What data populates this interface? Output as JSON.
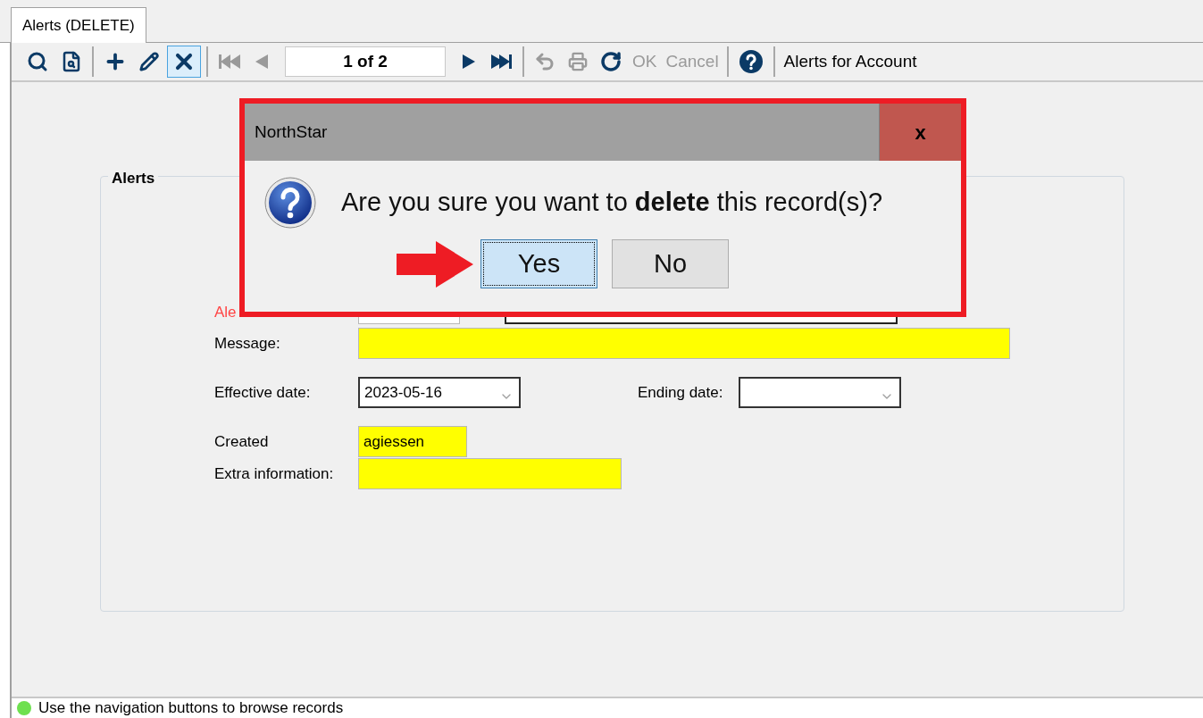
{
  "tab": {
    "label": "Alerts (DELETE)",
    "selected": true
  },
  "toolbar": [
    {
      "kind": "search",
      "disabled": false,
      "selected": false
    },
    {
      "kind": "find",
      "disabled": false,
      "selected": false
    },
    {
      "kind": "separator"
    },
    {
      "kind": "add",
      "disabled": false,
      "selected": false
    },
    {
      "kind": "edit",
      "disabled": false,
      "selected": false
    },
    {
      "kind": "delete",
      "disabled": false,
      "selected": true
    },
    {
      "kind": "separator"
    },
    {
      "kind": "first",
      "disabled": true,
      "selected": false
    },
    {
      "kind": "prev",
      "disabled": true,
      "selected": false
    },
    {
      "kind": "position",
      "text": "1 of 2"
    },
    {
      "kind": "next",
      "disabled": false,
      "selected": false
    },
    {
      "kind": "last",
      "disabled": false,
      "selected": false
    },
    {
      "kind": "separator"
    },
    {
      "kind": "undo",
      "disabled": true,
      "selected": false
    },
    {
      "kind": "print",
      "disabled": true,
      "selected": false
    },
    {
      "kind": "refresh",
      "disabled": false,
      "selected": false
    },
    {
      "kind": "text",
      "text": "OK",
      "disabled": true
    },
    {
      "kind": "text",
      "text": "Cancel",
      "disabled": true
    },
    {
      "kind": "separator"
    },
    {
      "kind": "help",
      "disabled": false,
      "selected": false
    },
    {
      "kind": "separator"
    },
    {
      "kind": "caption",
      "text": "Alerts for Account"
    }
  ],
  "group": {
    "title": "Alerts",
    "rows": [
      {
        "label": "Ale",
        "required": true,
        "fields": [
          {
            "kind": "hidden"
          }
        ]
      },
      {
        "label": "Message:",
        "required": false,
        "fields": [
          {
            "kind": "text",
            "highlighted": true
          }
        ]
      },
      {
        "label": "Effective date:",
        "required": false,
        "fields": [
          {
            "kind": "date",
            "value": "2023-05-16",
            "highlighted": false
          },
          {
            "kind": "label",
            "text": "Ending date:"
          },
          {
            "kind": "date",
            "highlighted": false
          }
        ]
      },
      {
        "label": "Created",
        "required": false,
        "fields": [
          {
            "kind": "text",
            "value": "agiessen",
            "highlighted": true
          }
        ]
      },
      {
        "label": "Extra information:",
        "required": false,
        "fields": [
          {
            "kind": "text",
            "highlighted": true
          }
        ]
      }
    ]
  },
  "dialog": {
    "title": "NorthStar",
    "close": "x",
    "message": "Are you sure you want to **delete** this record(s)?",
    "buttons": [
      {
        "label": "Yes",
        "selected": true
      },
      {
        "label": "No",
        "selected": false
      }
    ],
    "highlight_frame": true,
    "pointer_arrow": true
  },
  "status_bar": {
    "color": "#6ee04f",
    "text": "Use the navigation buttons to browse records"
  }
}
